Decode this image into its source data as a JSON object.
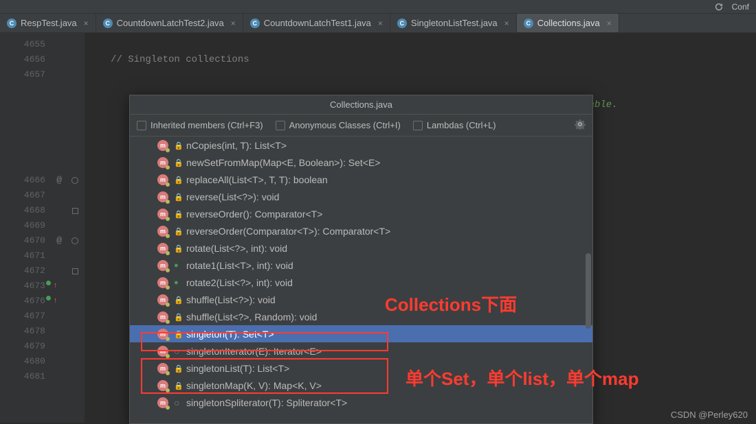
{
  "toolbar": {
    "conf_label": "Conf"
  },
  "tabs": [
    {
      "label": "RespTest.java"
    },
    {
      "label": "CountdownLatchTest2.java"
    },
    {
      "label": "CountdownLatchTest1.java"
    },
    {
      "label": "SingletonListTest.java"
    },
    {
      "label": "Collections.java"
    }
  ],
  "gutter_lines": [
    "4655",
    "4656",
    "4657",
    "",
    "",
    "",
    "",
    "",
    "",
    "4666",
    "4667",
    "4668",
    "4669",
    "4670",
    "4671",
    "4672",
    "4673",
    "4676",
    "4677",
    "4678",
    "4679",
    "4680",
    "4681"
  ],
  "at_lines": [
    "4666",
    "4670"
  ],
  "arrow_lines": [
    "4673",
    "4676"
  ],
  "code": {
    "comment": "// Singleton collections",
    "doc_tail": "alizable."
  },
  "popup": {
    "title": "Collections.java",
    "opt_inherited": "Inherited members (Ctrl+F3)",
    "opt_anon": "Anonymous Classes (Ctrl+I)",
    "opt_lambdas": "Lambdas (Ctrl+L)"
  },
  "methods": [
    {
      "access": "lock",
      "sig": "nCopies(int, T): List<T>"
    },
    {
      "access": "lock",
      "sig": "newSetFromMap(Map<E, Boolean>): Set<E>"
    },
    {
      "access": "lock",
      "sig": "replaceAll(List<T>, T, T): boolean"
    },
    {
      "access": "lock",
      "sig": "reverse(List<?>): void"
    },
    {
      "access": "lock",
      "sig": "reverseOrder(): Comparator<T>"
    },
    {
      "access": "lock",
      "sig": "reverseOrder(Comparator<T>): Comparator<T>"
    },
    {
      "access": "lock",
      "sig": "rotate(List<?>, int): void"
    },
    {
      "access": "open",
      "sig": "rotate1(List<T>, int): void"
    },
    {
      "access": "open",
      "sig": "rotate2(List<?>, int): void"
    },
    {
      "access": "lock",
      "sig": "shuffle(List<?>): void"
    },
    {
      "access": "lock",
      "sig": "shuffle(List<?>, Random): void"
    },
    {
      "access": "lock",
      "sig": "singleton(T): Set<T>",
      "selected": true
    },
    {
      "access": "abs",
      "sig": "singletonIterator(E): Iterator<E>"
    },
    {
      "access": "lock",
      "sig": "singletonList(T): List<T>"
    },
    {
      "access": "lock",
      "sig": "singletonMap(K, V): Map<K, V>"
    },
    {
      "access": "abs",
      "sig": "singletonSpliterator(T): Spliterator<T>"
    }
  ],
  "annotations": {
    "line1": "Collections下面",
    "line2": "单个Set，单个list，单个map"
  },
  "watermark": "CSDN @Perley620"
}
